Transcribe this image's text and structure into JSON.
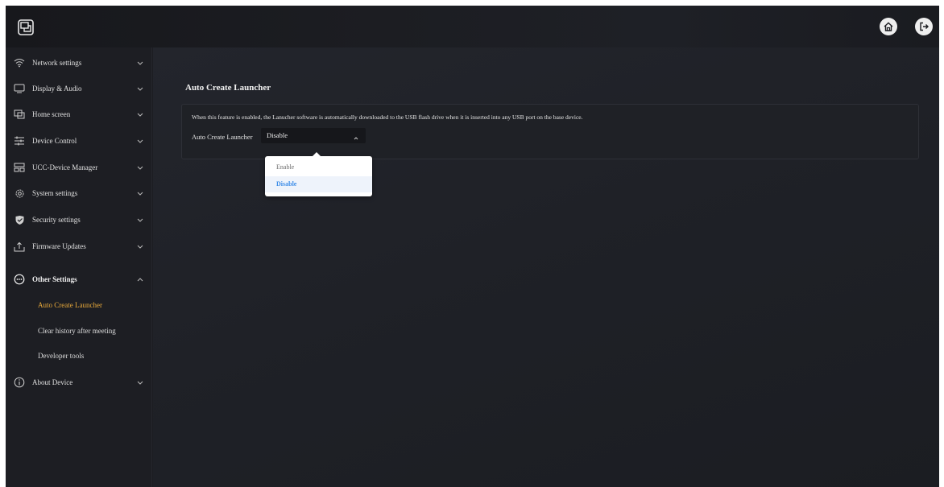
{
  "colors": {
    "accent": "#e8a93a",
    "selected_option": "#3e8ee8",
    "background": "#1b1c21"
  },
  "header": {
    "logo_icon": "screen-share-icon",
    "home_icon": "home-icon",
    "logout_icon": "logout-icon"
  },
  "sidebar": {
    "items": [
      {
        "label": "Network settings",
        "icon": "wifi-icon",
        "expanded": false
      },
      {
        "label": "Display & Audio",
        "icon": "monitor-icon",
        "expanded": false
      },
      {
        "label": "Home screen",
        "icon": "home-screen-icon",
        "expanded": false
      },
      {
        "label": "Device Control",
        "icon": "sliders-icon",
        "expanded": false
      },
      {
        "label": "UCC-Device Manager",
        "icon": "device-manager-icon",
        "expanded": false
      },
      {
        "label": "System settings",
        "icon": "gear-icon",
        "expanded": false
      },
      {
        "label": "Security settings",
        "icon": "shield-icon",
        "expanded": false
      },
      {
        "label": "Firmware Updates",
        "icon": "upload-icon",
        "expanded": false
      },
      {
        "label": "Other Settings",
        "icon": "more-icon",
        "expanded": true
      },
      {
        "label": "About Device",
        "icon": "info-icon",
        "expanded": false
      }
    ],
    "sub_items": [
      {
        "label": "Auto Create Launcher",
        "active": true
      },
      {
        "label": "Clear history after meeting",
        "active": false
      },
      {
        "label": "Developer tools",
        "active": false
      }
    ]
  },
  "main": {
    "title": "Auto Create Launcher",
    "description": "When this feature is enabled, the Lanucher software is automatically downloaded to the USB flash drive when it is inserted into any USB port on the base device.",
    "field_label": "Auto Create Launcher",
    "select_value": "Disable",
    "options": [
      "Enable",
      "Disable"
    ],
    "selected_option": "Disable"
  }
}
